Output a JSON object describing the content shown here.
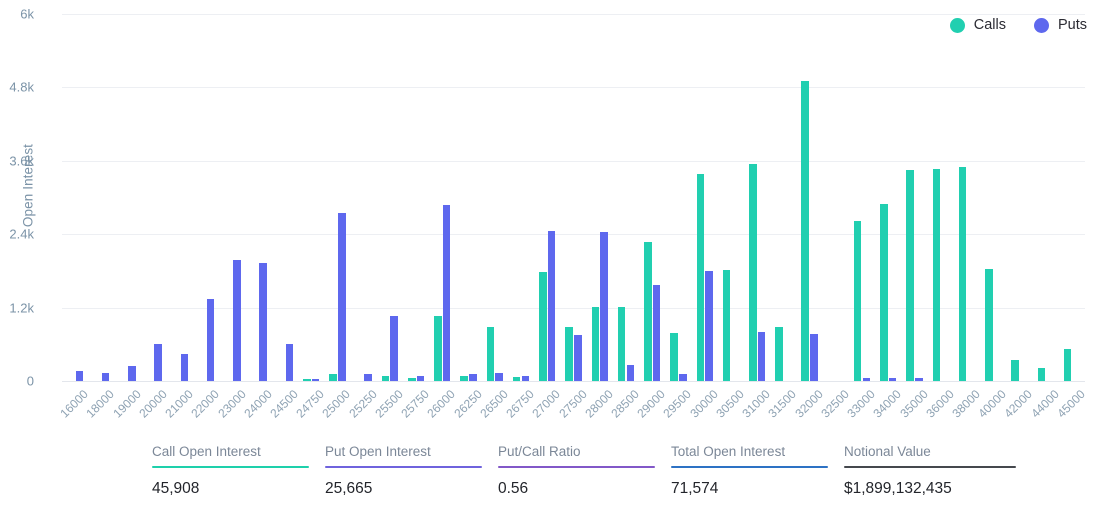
{
  "legend": {
    "items": [
      {
        "label": "Calls",
        "color": "#21cfb0",
        "icon": "circle-dot-icon"
      },
      {
        "label": "Puts",
        "color": "#5e68ee",
        "icon": "circle-dot-icon"
      }
    ]
  },
  "stats": [
    {
      "label": "Call Open Interest",
      "value": "45,908",
      "rule_color": "#1ed0ab"
    },
    {
      "label": "Put Open Interest",
      "value": "25,665",
      "rule_color": "#6f63dd"
    },
    {
      "label": "Put/Call Ratio",
      "value": "0.56",
      "rule_color": "#8258c8"
    },
    {
      "label": "Total Open Interest",
      "value": "71,574",
      "rule_color": "#2d72c4"
    },
    {
      "label": "Notional Value",
      "value": "$1,899,132,435",
      "rule_color": "#45484d"
    }
  ],
  "chart_data": {
    "type": "bar",
    "title": "",
    "xlabel": "",
    "ylabel": "Open Interest",
    "ylim": [
      0,
      6000
    ],
    "yticks": [
      0,
      1200,
      2400,
      3600,
      4800,
      6000
    ],
    "ytick_labels": [
      "0",
      "1.2k",
      "2.4k",
      "3.6k",
      "4.8k",
      "6k"
    ],
    "grid": true,
    "legend_position": "top-right",
    "grouping": "grouped",
    "categories": [
      "16000",
      "18000",
      "19000",
      "20000",
      "21000",
      "22000",
      "23000",
      "24000",
      "24500",
      "24750",
      "25000",
      "25250",
      "25500",
      "25750",
      "26000",
      "26250",
      "26500",
      "26750",
      "27000",
      "27500",
      "28000",
      "28500",
      "29000",
      "29500",
      "30000",
      "30500",
      "31000",
      "31500",
      "32000",
      "32500",
      "33000",
      "34000",
      "35000",
      "36000",
      "38000",
      "40000",
      "42000",
      "44000",
      "45000"
    ],
    "series": [
      {
        "name": "Calls",
        "color": "#21cfb0",
        "values": [
          0,
          0,
          0,
          0,
          0,
          0,
          0,
          0,
          0,
          40,
          110,
          0,
          80,
          55,
          1060,
          75,
          880,
          70,
          1790,
          880,
          1205,
          1210,
          2270,
          790,
          3390,
          1810,
          3540,
          880,
          4900,
          0,
          2620,
          2900,
          3450,
          3460,
          3500,
          1830,
          340,
          220,
          520
        ]
      },
      {
        "name": "Puts",
        "color": "#5e68ee",
        "values": [
          160,
          125,
          240,
          610,
          440,
          1345,
          1980,
          1930,
          610,
          30,
          2745,
          110,
          1070,
          75,
          2870,
          110,
          130,
          90,
          2450,
          760,
          2440,
          270,
          1570,
          120,
          1800,
          0,
          800,
          0,
          770,
          0,
          55,
          55,
          55,
          0,
          0,
          0,
          0,
          0,
          0
        ]
      }
    ]
  }
}
